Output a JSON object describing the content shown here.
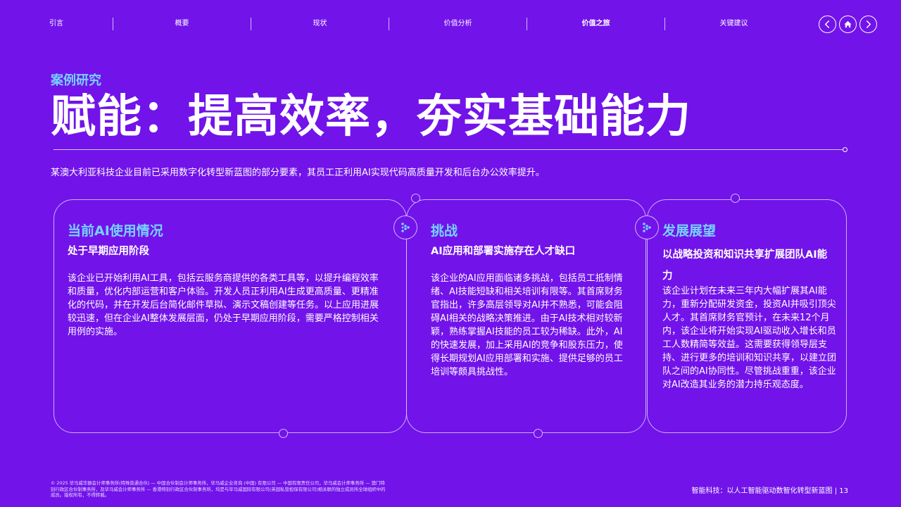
{
  "nav": {
    "items": [
      "引言",
      "概要",
      "现状",
      "价值分析",
      "价值之旅",
      "关键建议"
    ],
    "active_index": 4,
    "buttons": [
      "chevron-left-icon",
      "home-icon",
      "chevron-right-icon"
    ]
  },
  "header": {
    "section_label": "案例研究",
    "title": "赋能：提高效率，夯实基础能力",
    "intro": "某澳大利亚科技企业目前已采用数字化转型新蓝图的部分要素，其员工正利用AI实现代码高质量开发和后台办公效率提升。"
  },
  "cards": [
    {
      "title": "当前AI使用情况",
      "subtitle": "处于早期应用阶段",
      "body": "该企业已开始利用AI工具，包括云服务商提供的各类工具等，以提升编程效率和质量，优化内部运营和客户体验。开发人员正利用AI生成更高质量、更精准化的代码，并在开发后台简化邮件草拟、演示文稿创建等任务。以上应用进展较迅速，但在企业AI整体发展层面，仍处于早期应用阶段，需要严格控制相关用例的实施。"
    },
    {
      "title": "挑战",
      "subtitle": "AI应用和部署实施存在人才缺口",
      "body": "该企业的AI应用面临诸多挑战，包括员工抵制情绪、AI技能短缺和相关培训有限等。其首席财务官指出，许多高层领导对AI并不熟悉，可能会阻碍AI相关的战略决策推进。由于AI技术相对较新颖，熟练掌握AI技能的员工较为稀缺。此外，AI的快速发展，加上采用AI的竞争和股东压力，使得长期规划AI应用部署和实施、提供足够的员工培训等颇具挑战性。"
    },
    {
      "title": "发展展望",
      "subtitle": "以战略投资和知识共享扩展团队AI能力",
      "body": "该企业计划在未来三年内大幅扩展其AI能力，重新分配研发资金，投资AI并吸引顶尖人才。其首席财务官预计，在未来12个月内，该企业将开始实现AI驱动收入增长和员工人数精简等效益。这需要获得领导层支持、进行更多的培训和知识共享，以建立团队之间的AI协同性。尽管挑战重重，该企业对AI改造其业务的潜力持乐观态度。"
    }
  ],
  "footer": {
    "legal": "© 2025 毕马威华振会计师事务所(特殊普通合伙) — 中国合伙制会计师事务所，毕马威企业咨询 (中国) 有限公司 — 中国有限责任公司，毕马威会计师事务所 — 澳门特别行政区合伙制事务所，及毕马威会计师事务所 — 香港特别行政区合伙制事务所，均是与毕马威国际有限公司(英国私营担保有限公司)相关联的独立成员所全球组织中的成员。版权所有，不得转载。",
    "report_title": "智能科技：以人工智能驱动数智化转型新蓝图",
    "page_number": "13"
  },
  "colors": {
    "background": "#7213EA",
    "accent": "#76D2FF",
    "text": "#FFFFFF"
  }
}
